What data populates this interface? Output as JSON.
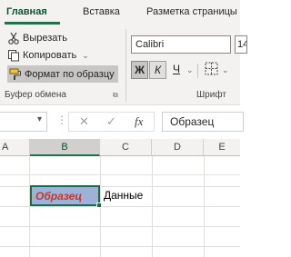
{
  "tabs": [
    {
      "label": "Главная",
      "active": true
    },
    {
      "label": "Вставка",
      "active": false
    },
    {
      "label": "Разметка страницы",
      "active": false
    }
  ],
  "clipboard": {
    "cut_label": "Вырезать",
    "copy_label": "Копировать",
    "format_painter_label": "Формат по образцу",
    "group_label": "Буфер обмена"
  },
  "font": {
    "name": "Calibri",
    "size": "14",
    "bold_label": "Ж",
    "italic_label": "К",
    "underline_label": "Ч",
    "group_label": "Шрифт"
  },
  "formula_bar": {
    "cancel_symbol": "✕",
    "enter_symbol": "✓",
    "fx_label": "fx",
    "value": "Образец"
  },
  "grid": {
    "columns": [
      "A",
      "B",
      "C",
      "D",
      "E"
    ],
    "selected_column": "B",
    "active_cell_text": "Образец",
    "neighbor_cell_text": "Данные"
  },
  "colors": {
    "accent": "#217346",
    "active_cell_fill": "#9db2d9",
    "active_cell_text": "#c0392b"
  }
}
